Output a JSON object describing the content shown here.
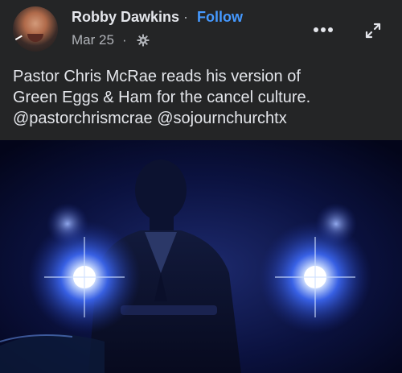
{
  "post": {
    "author": "Robby Dawkins",
    "separator": "·",
    "follow_label": "Follow",
    "timestamp": "Mar 25",
    "privacy_icon": "gear-icon",
    "caption_lines": [
      "Pastor Chris McRae reads his version of",
      "Green Eggs & Ham for the cancel culture.",
      "@pastorchrismcrae @sojournchurchtx"
    ]
  },
  "icons": {
    "more": "more-horizontal-icon",
    "expand": "expand-icon"
  },
  "colors": {
    "background": "#242526",
    "text_primary": "#e4e6eb",
    "text_secondary": "#b0b3b8",
    "link": "#4599ff",
    "video_light": "#3a6bff"
  }
}
